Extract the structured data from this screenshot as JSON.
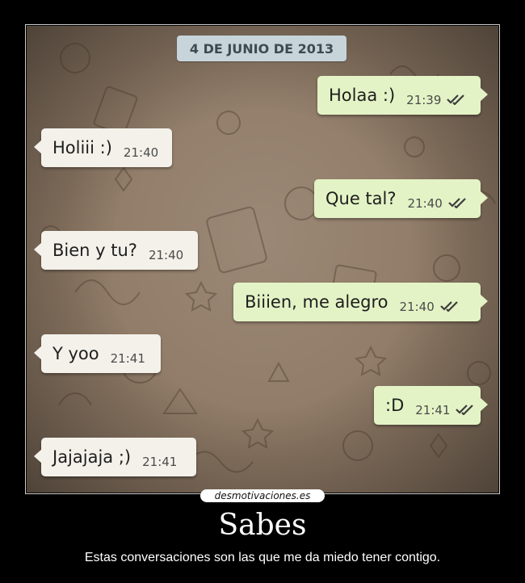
{
  "chat": {
    "date_label": "4 DE JUNIO DE 2013",
    "messages": [
      {
        "text": "Holaa :)",
        "time": "21:39"
      },
      {
        "text": "Holiii :)",
        "time": "21:40"
      },
      {
        "text": "Que tal?",
        "time": "21:40"
      },
      {
        "text": "Bien y tu?",
        "time": "21:40"
      },
      {
        "text": "Biiien, me alegro",
        "time": "21:40"
      },
      {
        "text": "Y yoo",
        "time": "21:41"
      },
      {
        "text": ":D",
        "time": "21:41"
      },
      {
        "text": "Jajajaja ;)",
        "time": "21:41"
      }
    ],
    "colors": {
      "outgoing": "#e4f3c6",
      "incoming": "#f3f1ea",
      "ticks": "#3d3d3d"
    },
    "icons": {
      "delivered": "double-check-icon"
    }
  },
  "poster": {
    "watermark": "desmotivaciones.es",
    "title": "Sabes",
    "caption": "Estas conversaciones son las que me da miedo tener contigo."
  }
}
